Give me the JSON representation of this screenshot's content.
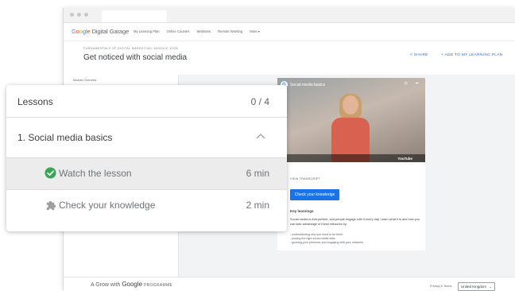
{
  "site": {
    "logo_google": [
      "G",
      "o",
      "o",
      "g",
      "l",
      "e"
    ],
    "logo_rest": "Digital Garage",
    "nav": [
      "My Learning Plan",
      "Online Courses",
      "Webinars",
      "Remote Working",
      "More ▾"
    ]
  },
  "module": {
    "eyebrow": "FUNDAMENTALS OF DIGITAL MARKETING: MODULE 10/26",
    "title": "Get noticed with social media",
    "share_label": "< SHARE",
    "add_plan_label": "+ ADD TO MY LEARNING PLAN",
    "overview_label": "Module Overview"
  },
  "video": {
    "title": "Social media basics",
    "watch_later": "Watch later",
    "share": "Share",
    "provider": "YouTube",
    "transcript_label": "VIEW TRANSCRIPT",
    "check_button": "Check your knowledge",
    "key_learnings_title": "Key learnings",
    "key_learnings_text": "Social media is everywhere, and people engage with it every day. Learn what it is and how you can take advantage of these networks by:",
    "key_points": [
      "understanding why you need to be there",
      "picking the right social media sites",
      "growing your presence and engaging with your networks"
    ]
  },
  "footer": {
    "grow_prefix": "A Grow with",
    "grow_brand": "Google",
    "grow_suffix": "PROGRAMME",
    "privacy": "Privacy & Terms",
    "region": "United Kingdom"
  },
  "lessons_panel": {
    "title": "Lessons",
    "progress": "0 / 4",
    "section_title": "1. Social media basics",
    "items": [
      {
        "label": "Watch the lesson",
        "duration": "6 min",
        "status": "completed",
        "icon": "check-circle-icon"
      },
      {
        "label": "Check your knowledge",
        "duration": "2 min",
        "status": "locked",
        "icon": "puzzle-icon"
      }
    ]
  },
  "colors": {
    "accent_blue": "#1a73e8",
    "check_green": "#34a853",
    "panel_selected_bg": "#ececec"
  }
}
